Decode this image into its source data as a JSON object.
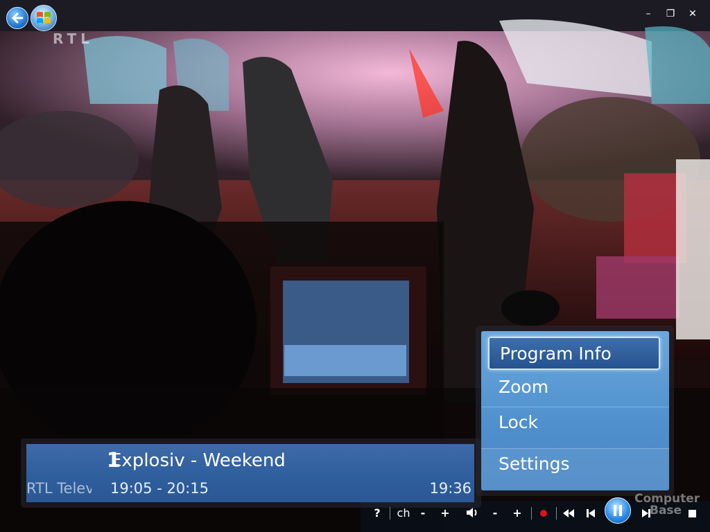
{
  "window": {
    "back_icon": "back-arrow-icon",
    "start_icon": "windows-orb-icon",
    "minimize": "–",
    "restore": "❐",
    "close": "✕"
  },
  "overlay": {
    "channel_logo": "RTL"
  },
  "menu": {
    "items": [
      {
        "label": "Program Info",
        "selected": true
      },
      {
        "label": "Zoom",
        "selected": false
      },
      {
        "label": "Lock",
        "selected": false
      },
      {
        "label": "Settings",
        "selected": false
      }
    ]
  },
  "info": {
    "channel_number": "1",
    "program_title": "Explosiv - Weekend",
    "channel_name": "RTL Television",
    "time_range": "19:05 - 20:15",
    "clock": "19:36"
  },
  "transport": {
    "help": "?",
    "ch": "ch",
    "ch_down": "-",
    "ch_up": "+",
    "vol_down": "-",
    "vol_up": "+"
  },
  "watermark": {
    "line1": "Computer",
    "line2": "Base"
  },
  "colors": {
    "menu_bg": "#5b9ad6",
    "info_bg": "#2f5e9e",
    "record": "#e01020"
  }
}
